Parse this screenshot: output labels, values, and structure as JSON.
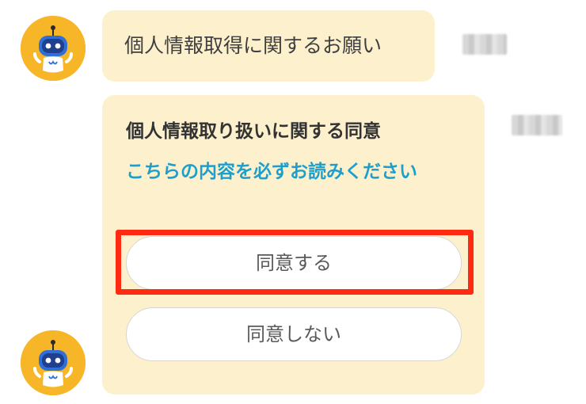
{
  "messages": [
    {
      "text": "個人情報取得に関するお願い",
      "timestamp": ""
    },
    {
      "title": "個人情報取り扱いに関する同意",
      "link": "こちらの内容を必ずお読みください",
      "timestamp": ""
    }
  ],
  "quick_replies": {
    "agree": "同意する",
    "disagree": "同意しない"
  },
  "colors": {
    "bubble_bg": "#fdf0cd",
    "avatar_bg": "#f7b627",
    "link": "#1e9fcb",
    "highlight": "#ff2a12"
  },
  "icons": {
    "avatar": "robot-icon"
  }
}
